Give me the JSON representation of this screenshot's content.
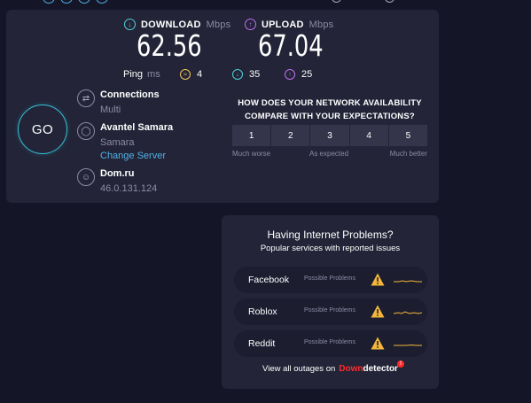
{
  "download": {
    "label": "DOWNLOAD",
    "unit": "Mbps",
    "value": "62.56"
  },
  "upload": {
    "label": "UPLOAD",
    "unit": "Mbps",
    "value": "67.04"
  },
  "ping": {
    "label": "Ping",
    "unit": "ms",
    "idle": "4",
    "download": "35",
    "upload": "25"
  },
  "go_label": "GO",
  "connections": {
    "title": "Connections",
    "value": "Multi"
  },
  "server": {
    "name": "Avantel Samara",
    "location": "Samara",
    "change_link": "Change Server"
  },
  "provider": {
    "name": "Dom.ru",
    "ip": "46.0.131.124"
  },
  "survey": {
    "question": "HOW DOES YOUR NETWORK AVAILABILITY COMPARE WITH YOUR EXPECTATIONS?",
    "options": [
      "1",
      "2",
      "3",
      "4",
      "5"
    ],
    "label_low": "Much worse",
    "label_mid": "As expected",
    "label_high": "Much better"
  },
  "problems": {
    "title": "Having Internet Problems?",
    "subtitle": "Popular services with reported issues",
    "services": [
      {
        "name": "Facebook",
        "status": "Possible Problems"
      },
      {
        "name": "Roblox",
        "status": "Possible Problems"
      },
      {
        "name": "Reddit",
        "status": "Possible Problems"
      }
    ],
    "outage_text": "View all outages on",
    "logo_part1": "Down",
    "logo_part2": "detector",
    "logo_badge": "!"
  },
  "colors": {
    "accent_download": "#4fd1d9",
    "accent_upload": "#bf71f2",
    "accent_idle": "#f4c55a",
    "link": "#4fb1e6",
    "warning": "#f4b73a",
    "panel": "#232437",
    "background": "#141526"
  }
}
